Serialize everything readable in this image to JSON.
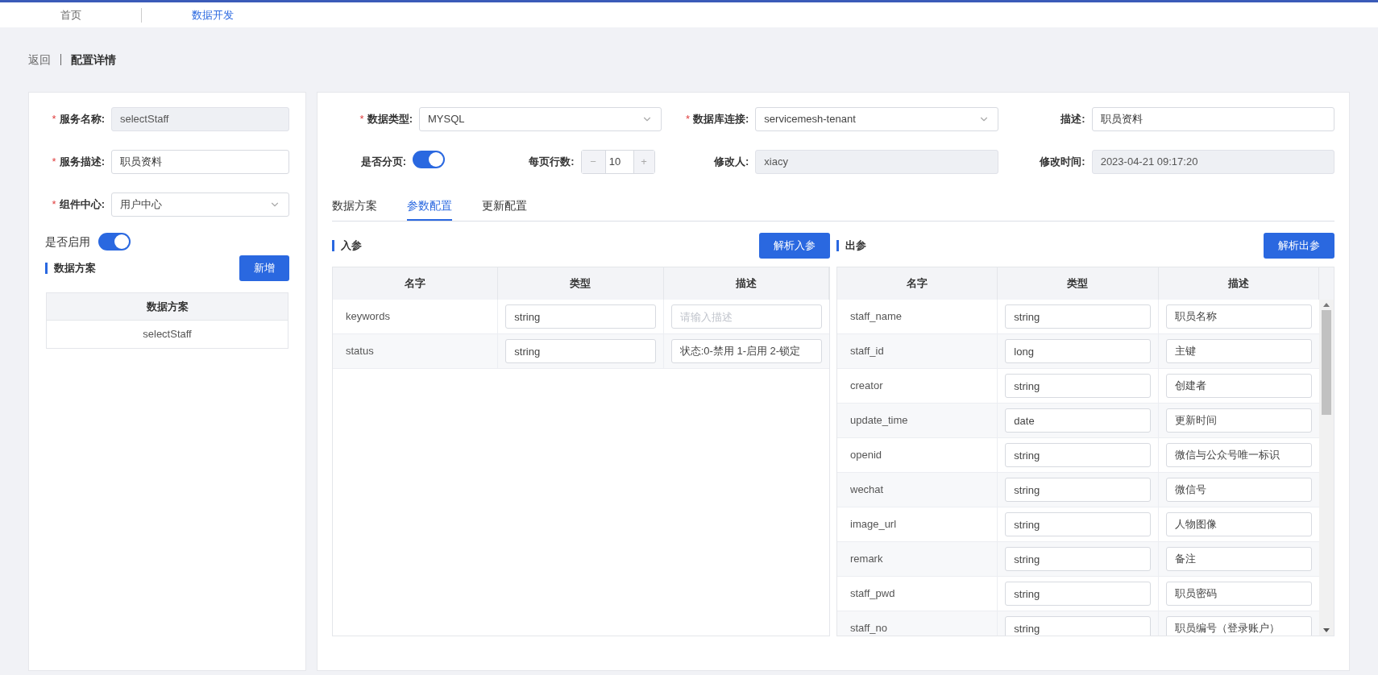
{
  "nav": {
    "tabs": [
      {
        "label": "首页",
        "selected": false
      },
      {
        "label": "数据开发",
        "selected": true
      }
    ]
  },
  "header": {
    "back": "返回",
    "title": "配置详情"
  },
  "left_form": {
    "fields": [
      {
        "kind": "input",
        "required_mark": "*",
        "label": "服务名称:",
        "value": "selectStaff",
        "disabled": true
      },
      {
        "kind": "input",
        "required_mark": "*",
        "label": "服务描述:",
        "value": "职员资料",
        "disabled": false
      },
      {
        "kind": "select",
        "required_mark": "*",
        "label": "组件中心:",
        "value": "用户中心"
      }
    ],
    "enable": {
      "label": "是否启用",
      "on": true
    },
    "section": {
      "title": "数据方案",
      "button": "新增"
    },
    "table": {
      "columns": [
        "数据方案"
      ],
      "rows": [
        [
          "selectStaff"
        ]
      ]
    }
  },
  "right_form": {
    "fields": [
      {
        "kind": "select",
        "required_mark": "*",
        "label": "数据类型:",
        "value": "MYSQL"
      },
      {
        "kind": "select",
        "required_mark": "*",
        "label": "数据库连接:",
        "value": "servicemesh-tenant"
      },
      {
        "kind": "input",
        "label": "描述:",
        "value": "职员资料",
        "disabled": false
      },
      {
        "kind": "switch",
        "label": "是否分页:",
        "on": true
      },
      {
        "kind": "stepper",
        "label": "每页行数:",
        "value": "10",
        "minus": "−",
        "plus": "+"
      },
      {
        "kind": "input",
        "label": "修改人:",
        "value": "xiacy",
        "disabled": true
      },
      {
        "kind": "input",
        "label": "修改时间:",
        "value": "2023-04-21 09:17:20",
        "disabled": true
      }
    ]
  },
  "tabs": [
    {
      "label": "数据方案",
      "selected": false
    },
    {
      "label": "参数配置",
      "selected": true
    },
    {
      "label": "更新配置",
      "selected": false
    }
  ],
  "in_params": {
    "title": "入参",
    "button": "解析入参",
    "columns": [
      "名字",
      "类型",
      "描述"
    ],
    "rows": [
      {
        "name": "keywords",
        "type": "string",
        "desc": "",
        "desc_placeholder": "请输入描述"
      },
      {
        "name": "status",
        "type": "string",
        "desc": "状态:0-禁用 1-启用 2-锁定"
      }
    ]
  },
  "out_params": {
    "title": "出参",
    "button": "解析出参",
    "columns": [
      "名字",
      "类型",
      "描述"
    ],
    "rows": [
      {
        "name": "staff_name",
        "type": "string",
        "desc": "职员名称"
      },
      {
        "name": "staff_id",
        "type": "long",
        "desc": "主键"
      },
      {
        "name": "creator",
        "type": "string",
        "desc": "创建者"
      },
      {
        "name": "update_time",
        "type": "date",
        "desc": "更新时间"
      },
      {
        "name": "openid",
        "type": "string",
        "desc": "微信与公众号唯一标识"
      },
      {
        "name": "wechat",
        "type": "string",
        "desc": "微信号"
      },
      {
        "name": "image_url",
        "type": "string",
        "desc": "人物图像"
      },
      {
        "name": "remark",
        "type": "string",
        "desc": "备注"
      },
      {
        "name": "staff_pwd",
        "type": "string",
        "desc": "职员密码"
      },
      {
        "name": "staff_no",
        "type": "string",
        "desc": "职员编号（登录账户）"
      }
    ]
  }
}
